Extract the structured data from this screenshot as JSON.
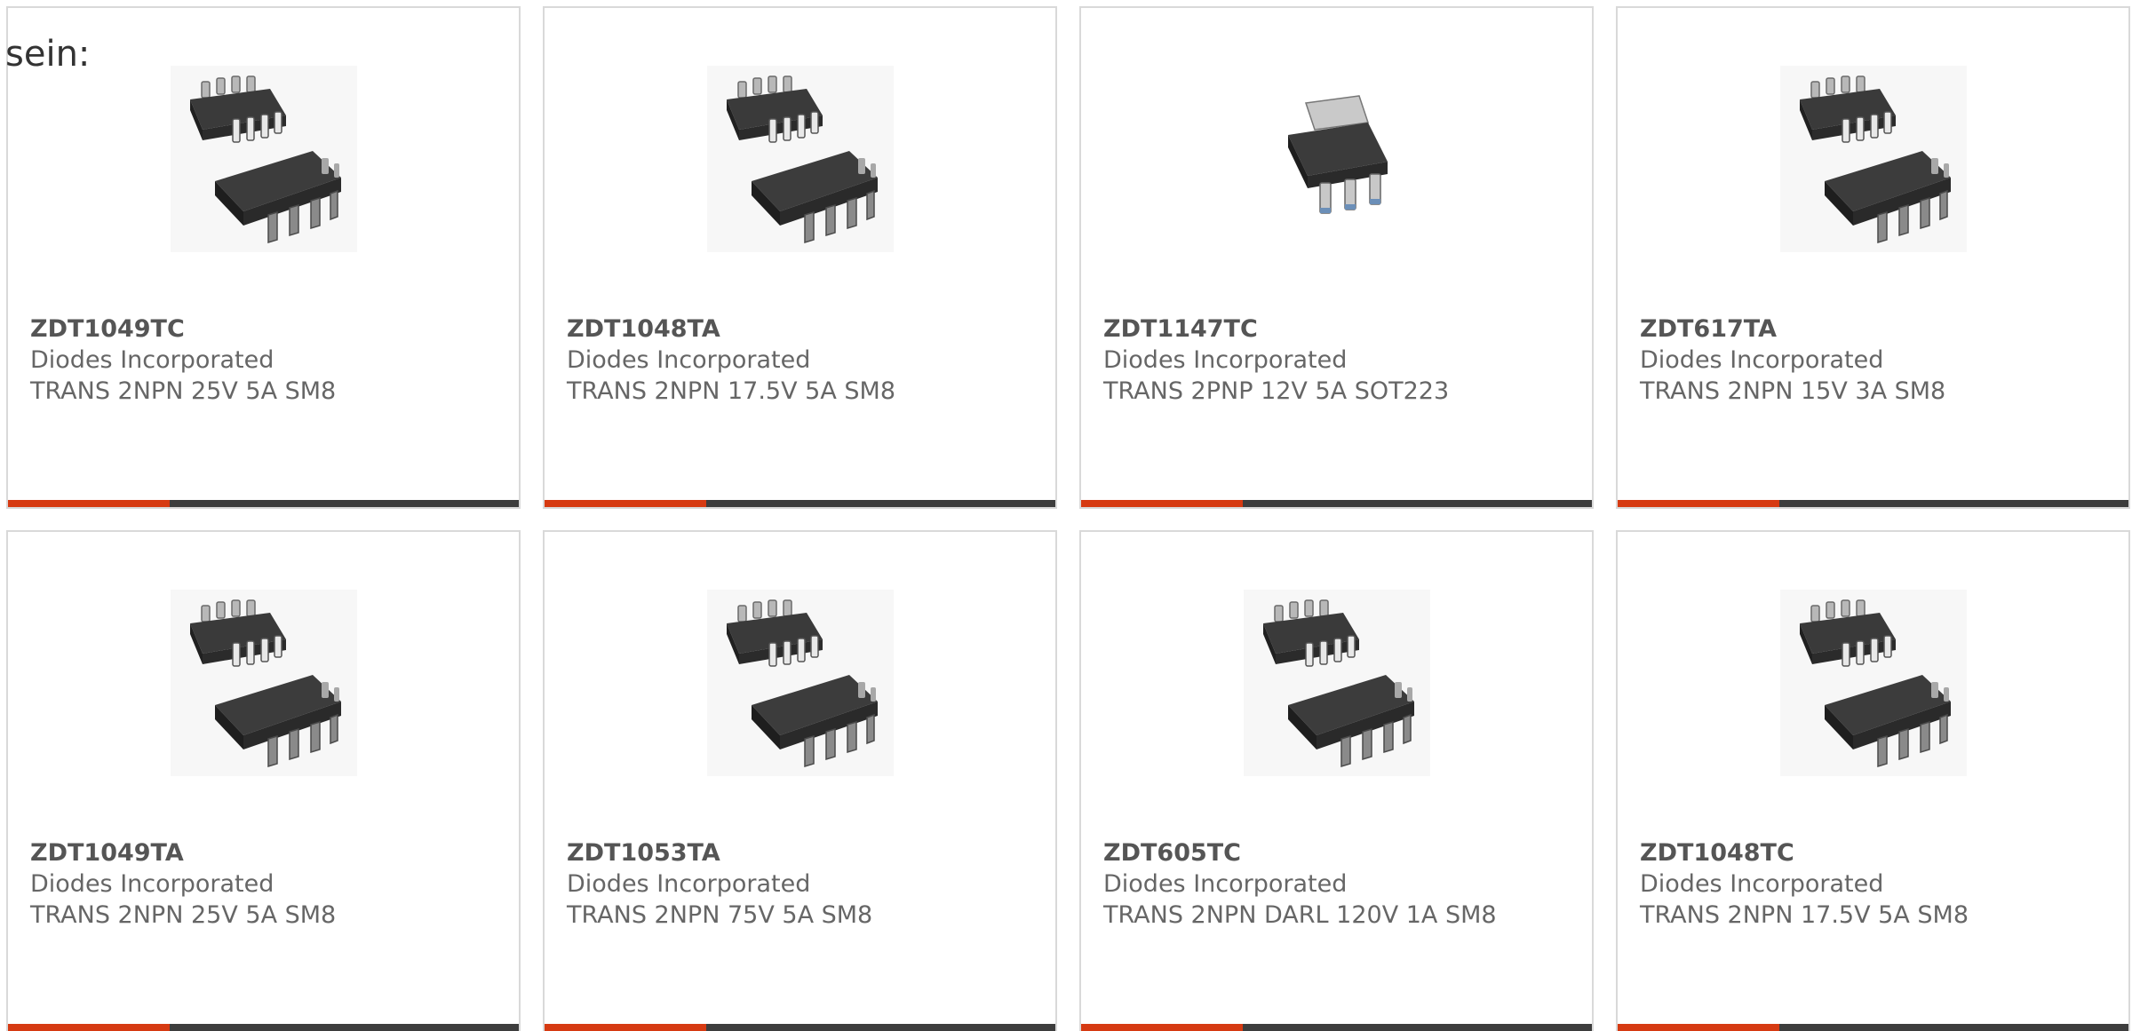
{
  "intro": {
    "text": "sein:"
  },
  "colors": {
    "accent": "#d63a12",
    "bar": "#3d3d3d",
    "card_border": "#d9d9d9",
    "text": "#666666"
  },
  "products": [
    {
      "part_number": "ZDT1049TC",
      "manufacturer": "Diodes Incorporated",
      "description": "TRANS 2NPN 25V 5A SM8",
      "image_icon": "sm8-chip-icon"
    },
    {
      "part_number": "ZDT1048TA",
      "manufacturer": "Diodes Incorporated",
      "description": "TRANS 2NPN 17.5V 5A SM8",
      "image_icon": "sm8-chip-icon"
    },
    {
      "part_number": "ZDT1147TC",
      "manufacturer": "Diodes Incorporated",
      "description": "TRANS 2PNP 12V 5A SOT223",
      "image_icon": "sot223-chip-icon"
    },
    {
      "part_number": "ZDT617TA",
      "manufacturer": "Diodes Incorporated",
      "description": "TRANS 2NPN 15V 3A SM8",
      "image_icon": "sm8-chip-icon"
    },
    {
      "part_number": "ZDT1049TA",
      "manufacturer": "Diodes Incorporated",
      "description": "TRANS 2NPN 25V 5A SM8",
      "image_icon": "sm8-chip-icon"
    },
    {
      "part_number": "ZDT1053TA",
      "manufacturer": "Diodes Incorporated",
      "description": "TRANS 2NPN 75V 5A SM8",
      "image_icon": "sm8-chip-icon"
    },
    {
      "part_number": "ZDT605TC",
      "manufacturer": "Diodes Incorporated",
      "description": "TRANS 2NPN DARL 120V 1A SM8",
      "image_icon": "sm8-chip-icon"
    },
    {
      "part_number": "ZDT1048TC",
      "manufacturer": "Diodes Incorporated",
      "description": "TRANS 2NPN 17.5V 5A SM8",
      "image_icon": "sm8-chip-icon"
    }
  ]
}
